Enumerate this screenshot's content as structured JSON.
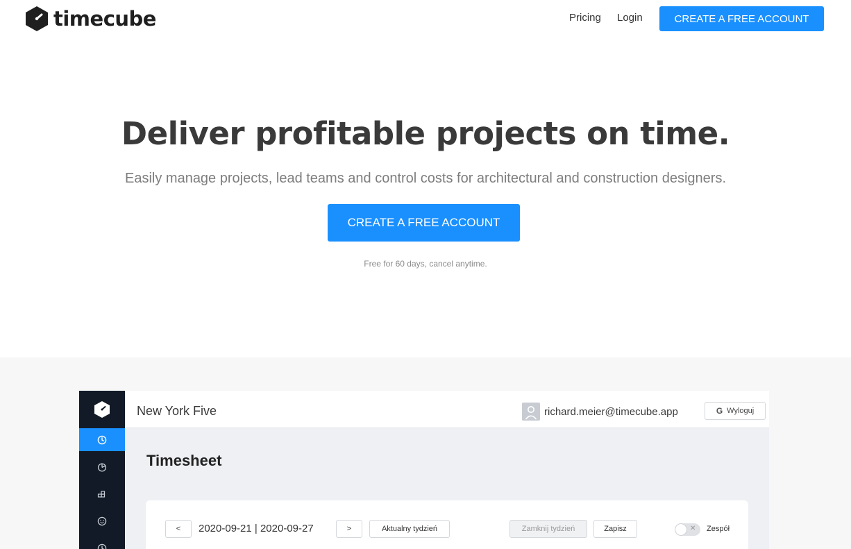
{
  "header": {
    "logo_text": "timecube",
    "nav": {
      "pricing": "Pricing",
      "login": "Login"
    },
    "cta_label": "CREATE A FREE ACCOUNT"
  },
  "hero": {
    "title": "Deliver profitable projects on time.",
    "subtitle": "Easily manage projects, lead teams and control costs for architectural and construction designers.",
    "cta_label": "CREATE A FREE ACCOUNT",
    "note": "Free for 60 days, cancel anytime."
  },
  "preview": {
    "sidebar": {
      "items": [
        {
          "icon": "clock-icon",
          "active": true
        },
        {
          "icon": "pie-chart-icon",
          "active": false
        },
        {
          "icon": "blocks-icon",
          "active": false
        },
        {
          "icon": "smiley-icon",
          "active": false
        },
        {
          "icon": "clock-icon",
          "active": false
        }
      ]
    },
    "header": {
      "project": "New York Five",
      "user_email": "richard.meier@timecube.app",
      "logout_icon": "G",
      "logout_label": "Wyloguj"
    },
    "page_title": "Timesheet",
    "toolbar": {
      "prev_label": "<",
      "date_range": "2020-09-21 | 2020-09-27",
      "next_label": ">",
      "current_week_label": "Aktualny tydzień",
      "close_week_label": "Zamknij tydzień",
      "save_label": "Zapisz",
      "toggle_x": "✕",
      "team_label": "Zespół"
    }
  },
  "colors": {
    "accent": "#1a90ff",
    "sidebar": "#111a26",
    "preview_background": "#eef0f4"
  }
}
